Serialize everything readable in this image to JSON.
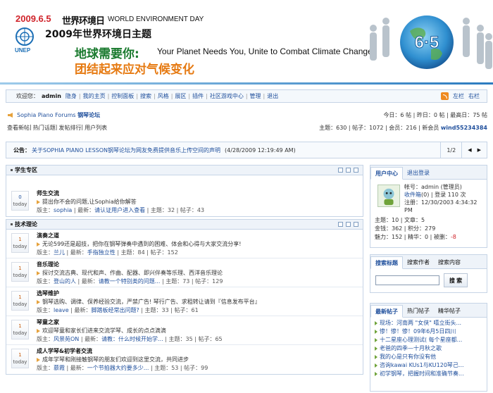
{
  "banner": {
    "date": "2009.6.5",
    "wed_cn": "世界环境日",
    "wed_en": "WORLD ENVIRONMENT DAY",
    "unep": "UNEP",
    "theme_title": "2009年世界环境日主题",
    "slogan_cn": "地球需要你:",
    "slogan_en": "Your Planet Needs You, Unite to Combat Climate Change",
    "slogan_cn2": "团结起来应对气候变化",
    "badge": "6·5"
  },
  "topnav": {
    "welcome": "欢迎您：",
    "username": "admin",
    "links": [
      "隐身",
      "我的主页",
      "控制面板",
      "搜索",
      "风格",
      "展区",
      "插件",
      "社区游戏中心",
      "管理",
      "退出"
    ],
    "right": [
      "左栏",
      "右栏"
    ]
  },
  "forum": {
    "title": "Sophia Piano Forums",
    "title_cn": "钢琴论坛",
    "subnav": [
      "查看新帖",
      "热门话题",
      "发帖排行",
      "用户列表"
    ],
    "stats_line1": "今日：6 帖 | 昨日：0 帖 | 最高日：75 帖",
    "stats_line2": "主题：630 | 帖子：1072 | 会员：216 | 新会员",
    "newest_member": "wind55234384"
  },
  "announcement": {
    "label": "公告：",
    "text": "关于SOPHIA PIANO LESSON钢琴论坛为网友免费提供音乐上传空间的声明",
    "time": "(4/28/2009 12:19:49 AM)",
    "page": "1/2"
  },
  "categories": [
    {
      "name": "学生专区",
      "forums": [
        {
          "count": "0",
          "today": "today",
          "name": "师生交流",
          "desc": "提出你不会的问题,让Sophia给你解答",
          "meta_pre": "版主：",
          "moderator": "sophia",
          "meta_mid": " | 最新：",
          "latest": "请认证用户进入查看",
          "meta_post": " | 主题：32 | 帖子：43"
        }
      ]
    },
    {
      "name": "技术理论",
      "forums": [
        {
          "count": "1",
          "today": "today",
          "name": "演奏之道",
          "desc": "无论599还是超技，把你在钢琴弹奏中遇到的困难、体会和心得与大家交流分享!",
          "meta_pre": "版主：",
          "moderator": "兰儿",
          "meta_mid": " | 最新：",
          "latest": "手指独立性",
          "meta_post": " | 主题：84 | 帖子：152"
        },
        {
          "count": "1",
          "today": "today",
          "name": "音乐理论",
          "desc": "探讨交流古典、现代和声、作曲、配器、即兴伴奏等乐理、西洋音乐理论",
          "meta_pre": "版主：",
          "moderator": "登山的人",
          "meta_mid": " | 最新：",
          "latest": "请教一个特别类的问题...",
          "meta_post": " | 主题：73 | 帖子：129"
        },
        {
          "count": "1",
          "today": "today",
          "name": "选琴维护",
          "desc": "钢琴选购、调律、保养经验交流，严禁广告! 琴行广告、求租转让请到『信息发布平台』",
          "meta_pre": "版主：",
          "moderator": "leave",
          "meta_mid": " | 最新：",
          "latest": "脚踏板经常出问题?",
          "meta_post": " | 主题：33 | 帖子：61"
        },
        {
          "count": "1",
          "today": "today",
          "name": "琴童之家",
          "desc": "欢迎琴童和家长们进来交流学琴、成长的点点滴滴",
          "meta_pre": "版主：",
          "moderator": "风景苑ON",
          "meta_mid": " | 最新：",
          "latest": "请教：什么时候开始学...",
          "meta_post": " | 主题：35 | 帖子：65"
        },
        {
          "count": "1",
          "today": "today",
          "name": "成人学琴&初学者交流",
          "desc": "成年学琴和刚接触钢琴的朋友们欢迎到这里交流，共同进步",
          "meta_pre": "版主：",
          "moderator": "慕霞",
          "meta_mid": " | 最新：",
          "latest": "一个节拍器大约要多少...",
          "meta_post": " | 主题：53 | 帖子：99"
        }
      ]
    }
  ],
  "user_center": {
    "tabs": [
      "用户中心",
      "退出登录"
    ],
    "account_line": "帐号：admin (管理员)",
    "inbox_label": "收件箱",
    "inbox_rest": "(0) | 登录  110 次",
    "registered": "注册：12/30/2003 4:34:32 PM",
    "stats": [
      "主题：10 | 文章：5",
      "金钱：362 | 积分：279"
    ],
    "stats3_pre": "魅力：152 | 精华：0 | 被删：",
    "deleted": "-8"
  },
  "search_box": {
    "tabs": [
      "搜索标题",
      "搜索作者",
      "搜索内容"
    ],
    "button": "搜 索"
  },
  "new_posts": {
    "tabs": [
      "最新帖子",
      "热门帖子",
      "精华帖子"
    ],
    "items": [
      "现场：河南两 \"女侠\" 嘻立街头...",
      "惨！惨！惨！09年6月5日四川",
      "十二星座心理测试( 每个星座都...",
      "老爸的四季—十月秋之歌",
      "我的心是只有你没有他",
      "咨询kawai KUs1与KU120琴己...",
      "初学钢琴，把握时间和准确节奏..."
    ]
  }
}
